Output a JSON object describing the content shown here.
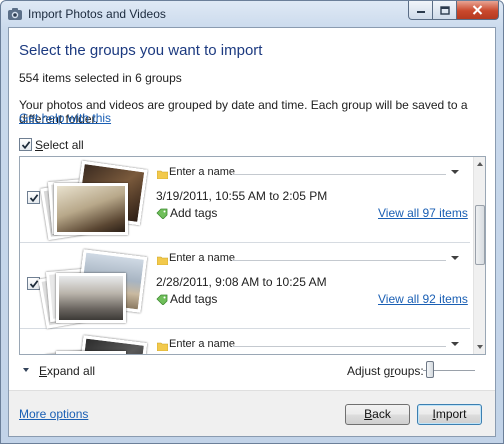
{
  "window": {
    "title": "Import Photos and Videos",
    "minimize_icon": "minimize-icon",
    "maximize_icon": "maximize-icon",
    "close_icon": "close-icon"
  },
  "header": {
    "heading": "Select the groups you want to import",
    "count_text": "554 items selected in 6 groups",
    "description": "Your photos and videos are grouped by date and time. Each group will be saved to a different folder.",
    "help_link": "Get help with this"
  },
  "select_all": {
    "accel": "S",
    "rest": "elect all",
    "checked": true
  },
  "groups": [
    {
      "checked": true,
      "name_placeholder": "Enter a name",
      "date_range": "3/19/2011, 10:55 AM to 2:05 PM",
      "add_tags": "Add tags",
      "view_all": "View all 97 items"
    },
    {
      "checked": true,
      "name_placeholder": "Enter a name",
      "date_range": "2/28/2011, 9:08 AM to 10:25 AM",
      "add_tags": "Add tags",
      "view_all": "View all 92 items"
    },
    {
      "name_placeholder": "Enter a name"
    }
  ],
  "controls": {
    "expand_accel": "E",
    "expand_rest": "xpand all",
    "adjust_pre": "Adjust g",
    "adjust_accel": "r",
    "adjust_post": "oups:"
  },
  "footer": {
    "more_options": "More options",
    "back_accel": "B",
    "back_rest": "ack",
    "import_accel": "I",
    "import_rest": "mport"
  },
  "colors": {
    "link": "#1a5fb4",
    "heading": "#1c3a80",
    "close_button": "#c9482c"
  }
}
